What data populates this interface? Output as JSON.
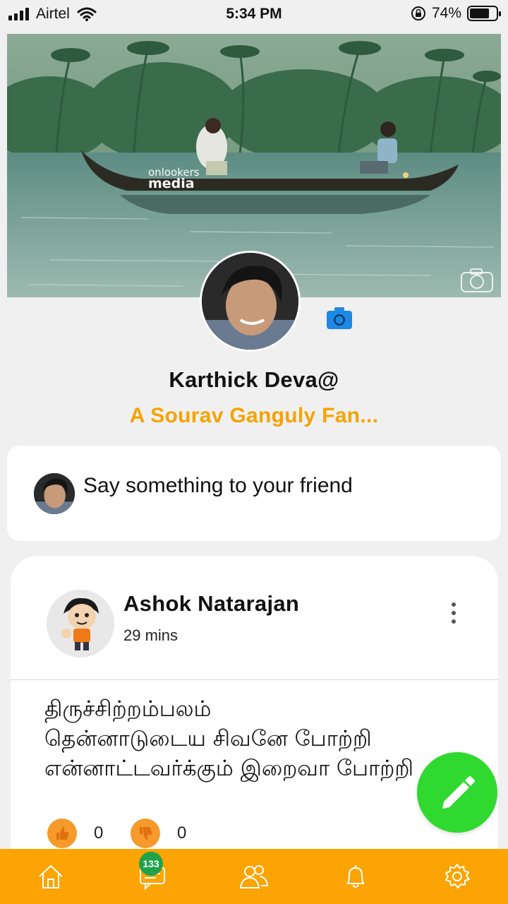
{
  "status_bar": {
    "carrier": "Airtel",
    "time": "5:34 PM",
    "battery_percent": "74%",
    "battery_level": 0.74
  },
  "cover": {
    "watermark_line1": "onlookers",
    "watermark_line2": "media"
  },
  "profile": {
    "name": "Karthick  Deva@",
    "status": "A  Sourav Ganguly Fan..."
  },
  "compose": {
    "placeholder": "Say something to your friend"
  },
  "post": {
    "author": "Ashok  Natarajan",
    "time": "29 mins",
    "body": "திருச்சிற்றம்பலம்\n தென்னாடுடைய சிவனே போற்றி\nஎன்னாட்டவர்க்கும் இறைவா போற்றி",
    "likes": "0",
    "dislikes": "0"
  },
  "nav": {
    "items": [
      "home-icon",
      "chat-icon",
      "friends-icon",
      "bell-icon",
      "settings-icon"
    ],
    "chat_badge": "133"
  },
  "colors": {
    "accent": "#fba404",
    "status_orange": "#f5a300",
    "fab_green": "#2fd92f",
    "badge_green": "#1fa24a",
    "camera_blue": "#1e88e5"
  }
}
